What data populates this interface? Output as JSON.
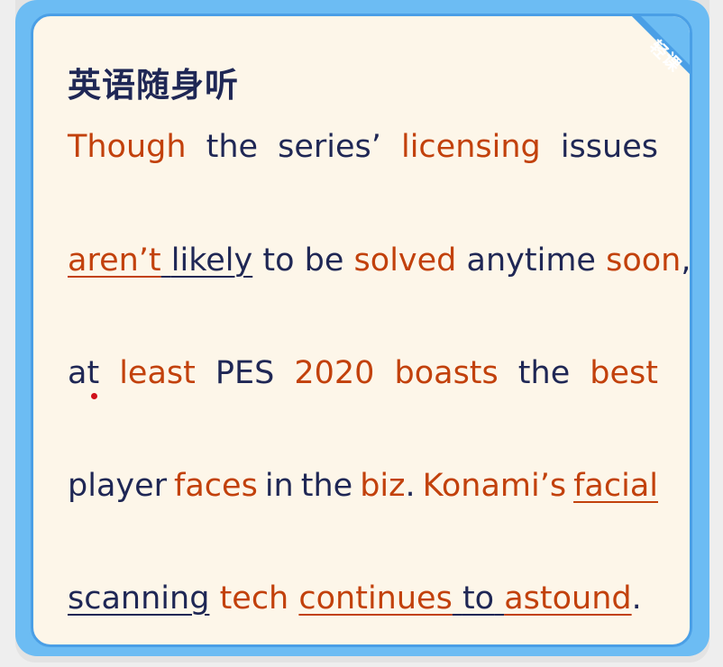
{
  "header": {
    "title": "英语随身听",
    "corner_badge": "轻课"
  },
  "colors": {
    "frame": "#6cbcf3",
    "card_border": "#4a9fe6",
    "card_background": "#fdf6e9",
    "text_default": "#1f2755",
    "text_highlight": "#c2410c",
    "marker": "#d0101a"
  },
  "passage": {
    "line1": [
      "Though",
      "the",
      "series’",
      "licensing",
      "issues"
    ],
    "line2": [
      "aren’t",
      "likely",
      "to",
      "be",
      "solved",
      "anytime",
      "soon",
      ","
    ],
    "line3": [
      "at",
      "least",
      "PES",
      "2020",
      "boasts",
      "the",
      "best"
    ],
    "line4": [
      "player",
      "faces",
      "in",
      "the",
      "biz",
      ".",
      "Konami’s",
      "facial"
    ],
    "line5": [
      "scanning",
      "tech",
      "continues",
      "to",
      "astound",
      "."
    ]
  }
}
